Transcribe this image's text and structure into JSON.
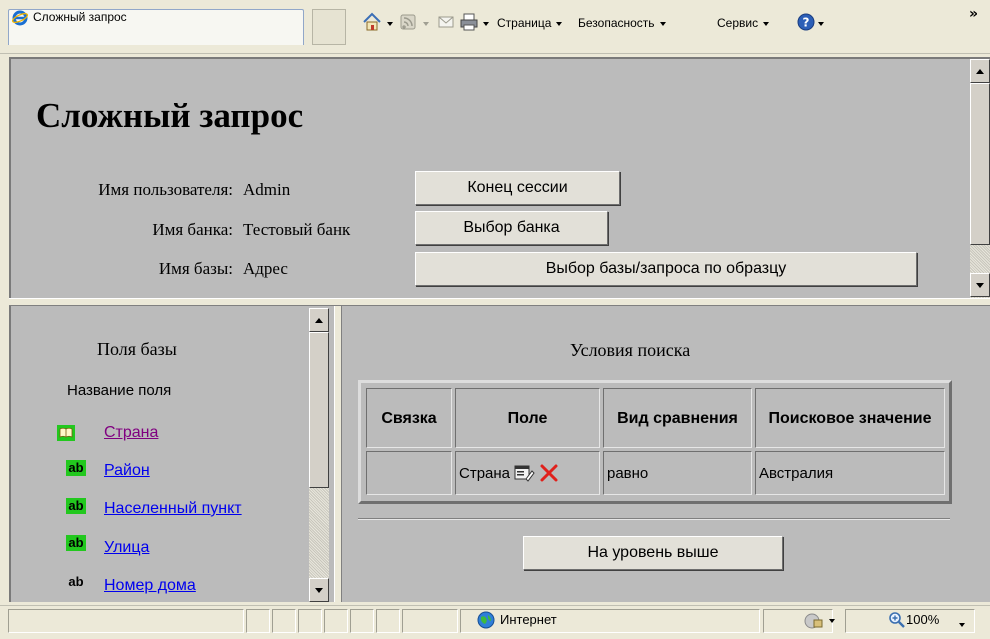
{
  "browser": {
    "tab_title": "Сложный запрос",
    "menu": {
      "page": "Страница",
      "security": "Безопасность",
      "service": "Сервис",
      "overflow": "»"
    }
  },
  "header": {
    "title": "Сложный запрос",
    "user_label": "Имя пользователя:",
    "user_value": "Admin",
    "bank_label": "Имя банка:",
    "bank_value": "Тестовый банк",
    "db_label": "Имя базы:",
    "db_value": "Адрес",
    "btn_end_session": "Конец сессии",
    "btn_select_bank": "Выбор банка",
    "btn_select_db": "Выбор базы/запроса по образцу"
  },
  "fields_panel": {
    "title": "Поля базы",
    "column_header": "Название поля",
    "items": [
      {
        "label": "Страна",
        "icon": "book-icon"
      },
      {
        "label": "Район",
        "icon": "ab-text-icon"
      },
      {
        "label": "Населенный пункт",
        "icon": "ab-text-icon"
      },
      {
        "label": "Улица",
        "icon": "ab-text-icon"
      },
      {
        "label": "Номер дома",
        "icon": "ab-text-icon"
      }
    ],
    "ab_text": "ab"
  },
  "conditions": {
    "title": "Условия поиска",
    "headers": {
      "link": "Связка",
      "field": "Поле",
      "compare": "Вид сравнения",
      "value": "Поисковое значение"
    },
    "rows": [
      {
        "link": "",
        "field": "Страна",
        "compare": "равно",
        "value": "Австралия"
      }
    ],
    "btn_up": "На уровень выше"
  },
  "statusbar": {
    "zone": "Интернет",
    "zoom": "100%"
  },
  "colors": {
    "frame_bg": "#bbbbbb",
    "chrome_bg": "#ece9d8",
    "link": "#0000ee",
    "visited": "#800080",
    "ab_green": "#22c81e",
    "delete_red": "#e0201b"
  }
}
